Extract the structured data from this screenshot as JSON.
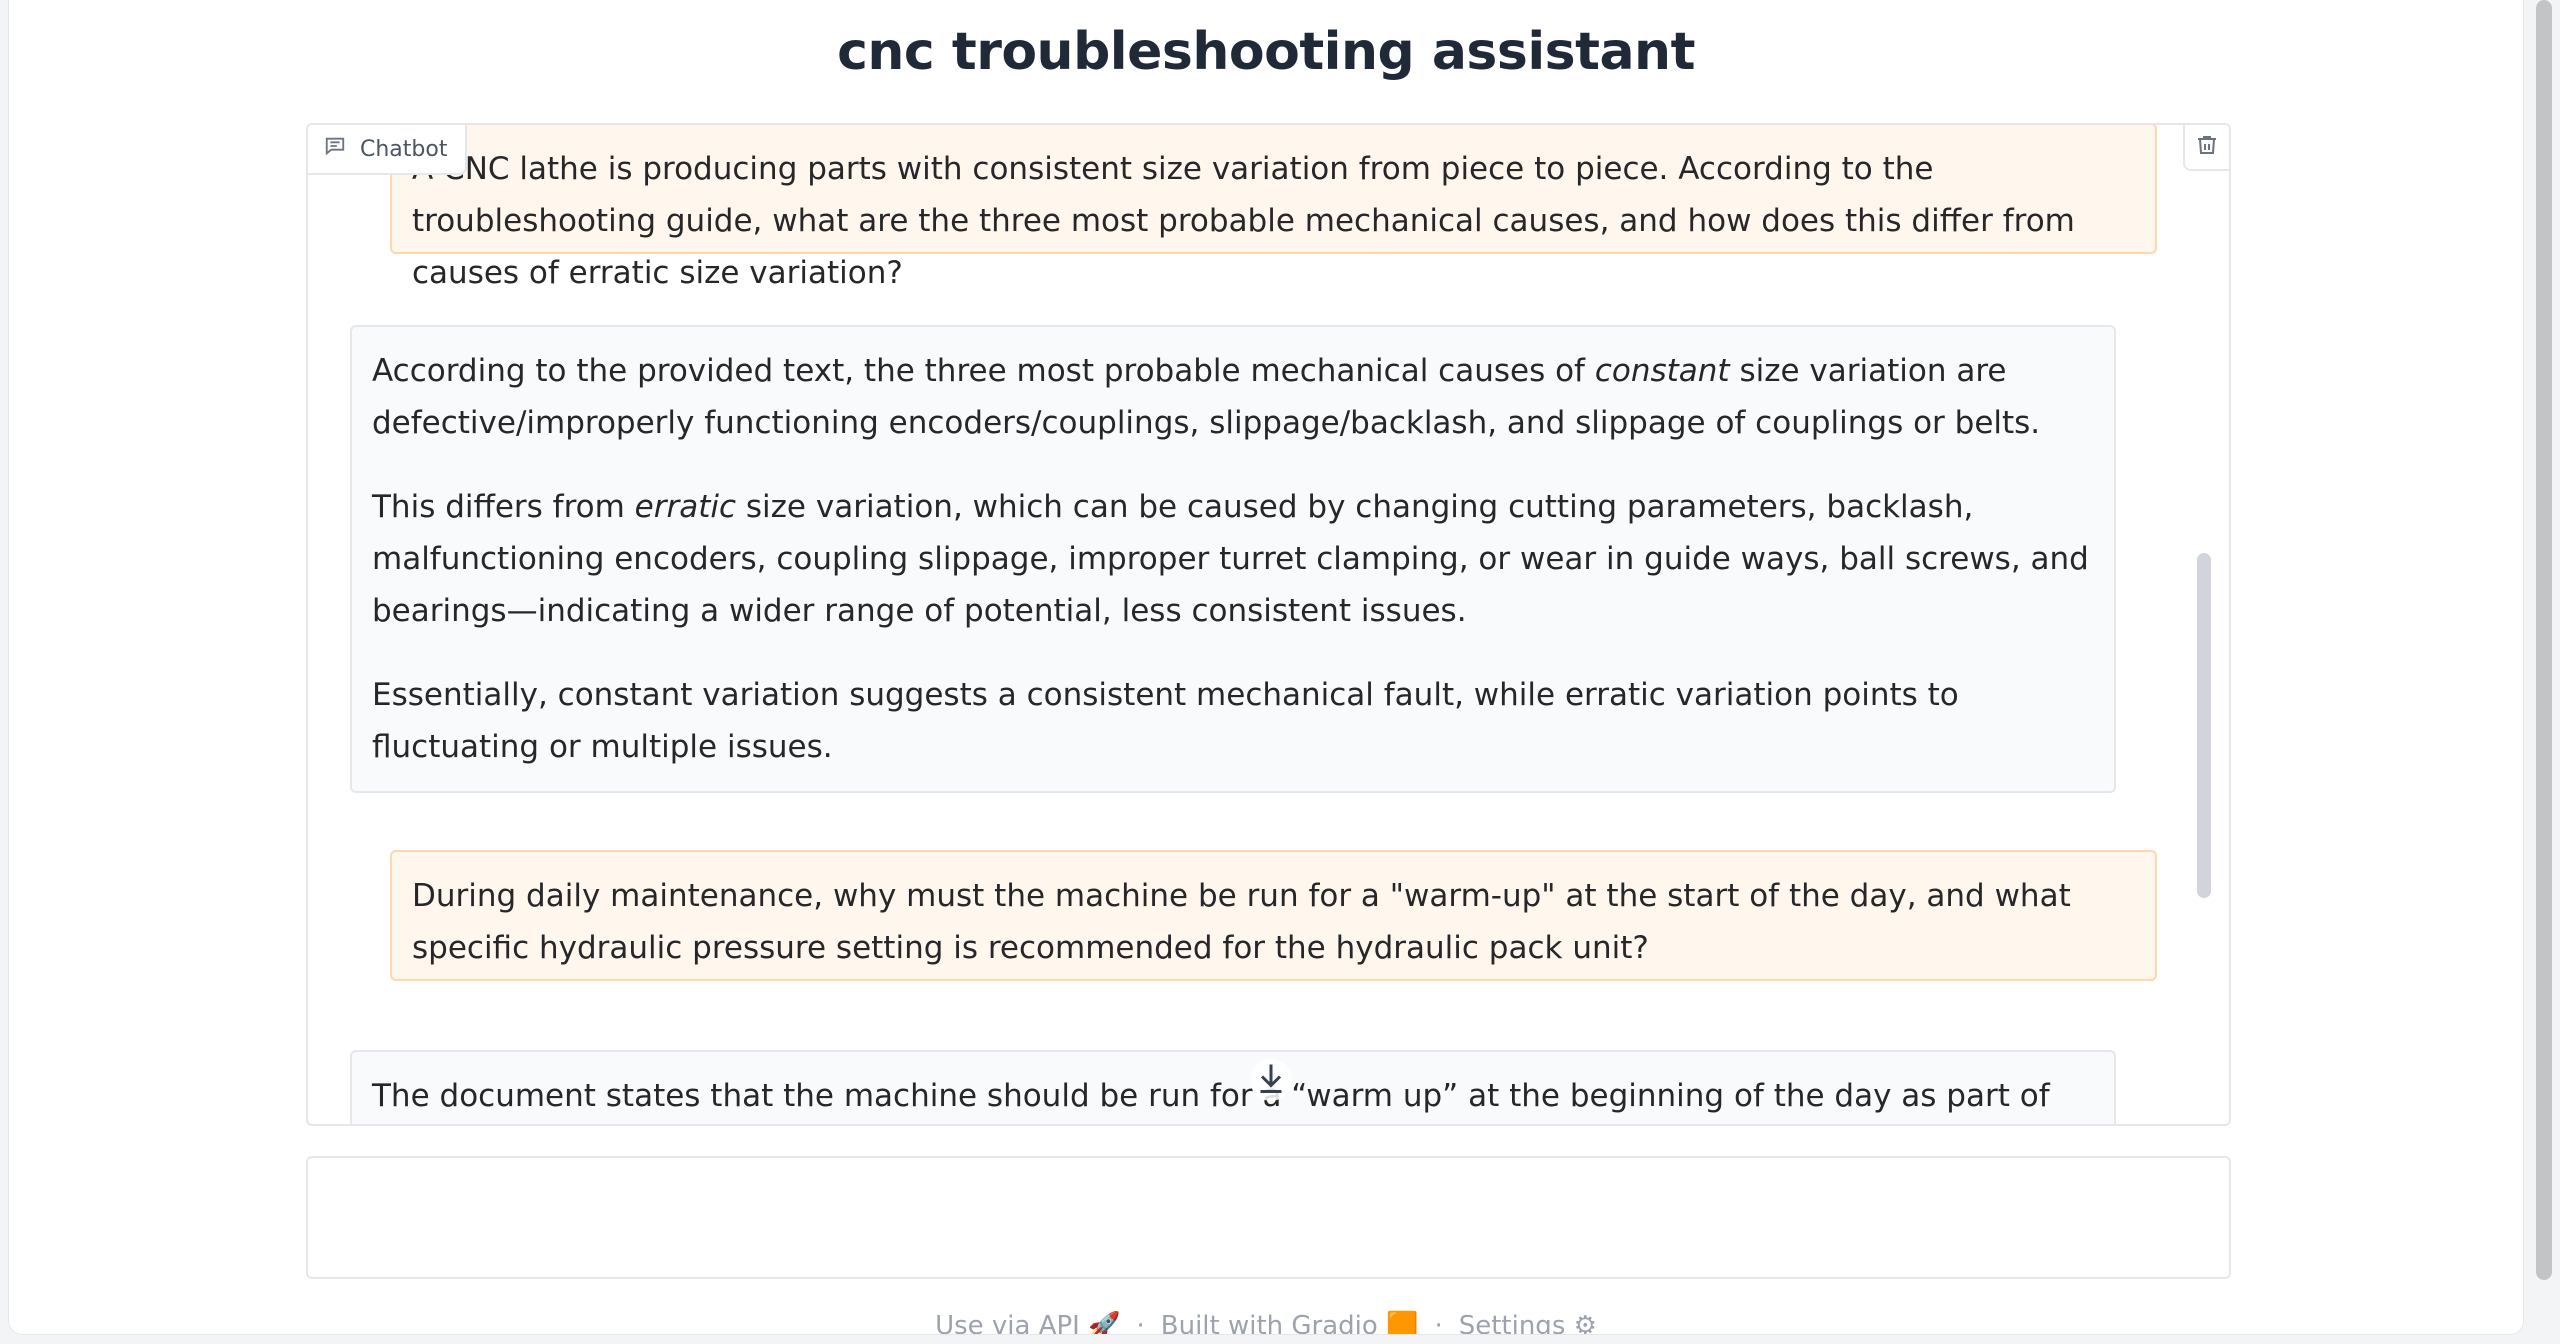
{
  "app": {
    "title": "cnc troubleshooting assistant"
  },
  "chatbot": {
    "label": "Chatbot",
    "label_icon": "chat-icon",
    "clear_icon": "trash-icon",
    "messages": [
      {
        "role": "user",
        "paragraphs": [
          "A CNC lathe is producing parts with consistent size variation from piece to piece. According to the troubleshooting guide, what are the three most probable mechanical causes, and how does this differ from causes of erratic size variation?"
        ]
      },
      {
        "role": "bot",
        "p1_before": "According to the provided text, the three most probable mechanical causes of ",
        "p1_em": "constant",
        "p1_after": " size variation are defective/improperly functioning encoders/couplings, slippage/backlash, and slippage of couplings or belts.",
        "p2_before": "This differs from ",
        "p2_em": "erratic",
        "p2_after": " size variation, which can be caused by changing cutting parameters, backlash, malfunctioning encoders, coupling slippage, improper turret clamping, or wear in guide ways, ball screws, and bearings—indicating a wider range of potential, less consistent issues.",
        "p3": "Essentially, constant variation suggests a consistent mechanical fault, while erratic variation points to fluctuating or multiple issues."
      },
      {
        "role": "user",
        "text": "During daily maintenance, why must the machine be run for a \"warm-up\" at the start of the day, and what specific hydraulic pressure setting is recommended for the hydraulic pack unit?"
      },
      {
        "role": "bot",
        "text": "The document states that the machine should be run for a “warm up” at the beginning of the day as part of the daily maintenance"
      }
    ],
    "scroll_down_icon": "arrow-down-icon"
  },
  "input": {
    "placeholder": "",
    "value": ""
  },
  "footer": {
    "api": "Use via API",
    "api_icon": "🚀",
    "built": "Built with Gradio",
    "built_icon": "🟧",
    "settings": "Settings",
    "settings_icon": "⚙",
    "separator": "·"
  }
}
